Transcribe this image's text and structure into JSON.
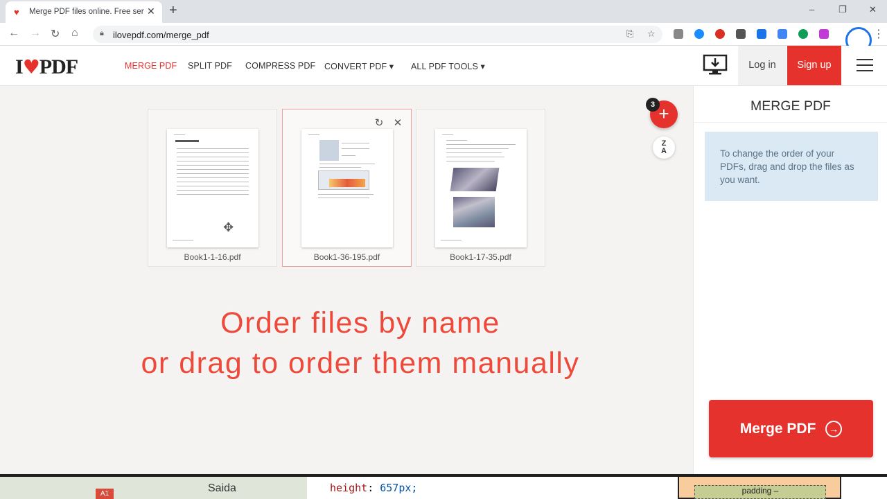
{
  "browser": {
    "tab_title": "Merge PDF files online. Free service",
    "url": "ilovepdf.com/merge_pdf",
    "new_tab": "+",
    "win_min": "–",
    "win_restore": "❐",
    "win_close": "✕",
    "tab_close": "✕"
  },
  "header": {
    "logo_left": "I",
    "logo_right": "PDF",
    "nav": [
      {
        "label": "MERGE PDF",
        "active": true
      },
      {
        "label": "SPLIT PDF"
      },
      {
        "label": "COMPRESS PDF"
      },
      {
        "label": "CONVERT PDF ▾"
      },
      {
        "label": "ALL PDF TOOLS ▾"
      }
    ],
    "login": "Log in",
    "signup": "Sign up"
  },
  "workspace": {
    "files": [
      {
        "name": "Book1-1-16.pdf",
        "selected": false
      },
      {
        "name": "Book1-36-195.pdf",
        "selected": true
      },
      {
        "name": "Book1-17-35.pdf",
        "selected": false
      }
    ],
    "file_count_badge": "3",
    "add_symbol": "+",
    "sort_top": "Z",
    "sort_bottom": "A",
    "overlay_line1": "Order files by name",
    "overlay_line2": "or drag to order them manually"
  },
  "sidebar": {
    "title": "MERGE PDF",
    "info": "To change the order of your PDFs, drag and drop the files as you want.",
    "merge_button": "Merge PDF"
  },
  "background_windows": {
    "map_label": "Saida",
    "map_pin": "A1",
    "code_key": "height",
    "code_value": "657px;",
    "box_label": "padding –"
  },
  "colors": {
    "brand_red": "#e5322d",
    "info_bg": "#dbe9f5",
    "workspace_bg": "#f4f3f1"
  }
}
